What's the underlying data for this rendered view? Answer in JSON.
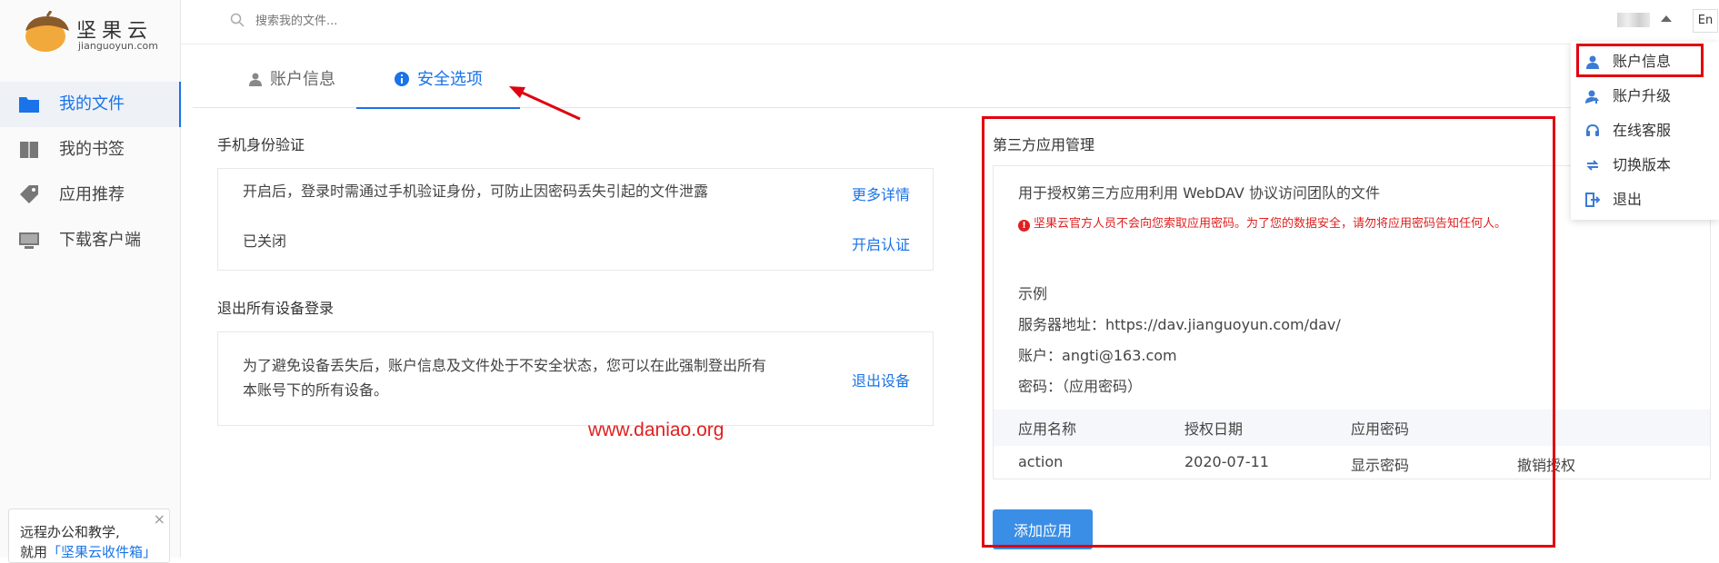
{
  "app": {
    "logo_text": "坚果云",
    "logo_sub": "jianguoyun.com"
  },
  "sidebar": {
    "items": [
      {
        "label": "我的文件",
        "icon": "folder-icon",
        "active": true
      },
      {
        "label": "我的书签",
        "icon": "bookmark-icon",
        "active": false
      },
      {
        "label": "应用推荐",
        "icon": "tag-icon",
        "active": false
      },
      {
        "label": "下载客户端",
        "icon": "monitor-icon",
        "active": false
      }
    ],
    "promo": {
      "line1": "远程办公和教学,",
      "line2_prefix": "就用",
      "line2_link": "「坚果云收件箱」",
      "close": "×"
    }
  },
  "topbar": {
    "search_placeholder": "搜索我的文件...",
    "lang": "En"
  },
  "tabs": [
    {
      "label": "账户信息",
      "icon": "user-icon",
      "active": false
    },
    {
      "label": "安全选项",
      "icon": "info-icon",
      "active": true
    }
  ],
  "phone_auth": {
    "title": "手机身份验证",
    "description": "开启后，登录时需通过手机验证身份，可防止因密码丢失引起的文件泄露",
    "more_link": "更多详情",
    "status": "已关闭",
    "enable_link": "开启认证"
  },
  "logout_all": {
    "title": "退出所有设备登录",
    "description_line1": "为了避免设备丢失后，账户信息及文件处于不安全状态，您可以在此强制登出所有",
    "description_line2": "本账号下的所有设备。",
    "action_link": "退出设备"
  },
  "watermark": "www.daniao.org",
  "third_party": {
    "title": "第三方应用管理",
    "description": "用于授权第三方应用利用 WebDAV 协议访问团队的文件",
    "warning": "坚果云官方人员不会向您索取应用密码。为了您的数据安全，请勿将应用密码告知任何人。",
    "example": {
      "title": "示例",
      "server_label": "服务器地址：",
      "server_value": "https://dav.jianguoyun.com/dav/",
      "account_label": "账户：",
      "account_value": "angti@163.com",
      "password_label": "密码：",
      "password_value": "（应用密码）"
    },
    "table": {
      "headers": [
        "应用名称",
        "授权日期",
        "应用密码"
      ],
      "rows": [
        {
          "name": "action",
          "date": "2020-07-11",
          "show_password": "显示密码",
          "revoke": "撤销授权"
        }
      ]
    },
    "add_button": "添加应用"
  },
  "dropdown": {
    "items": [
      {
        "label": "账户信息",
        "icon": "user-icon"
      },
      {
        "label": "账户升级",
        "icon": "user-upgrade-icon"
      },
      {
        "label": "在线客服",
        "icon": "headset-icon"
      },
      {
        "label": "切换版本",
        "icon": "switch-icon"
      },
      {
        "label": "退出",
        "icon": "logout-icon"
      }
    ]
  },
  "colors": {
    "accent": "#1a73e8",
    "annotation": "#e00010",
    "warning": "#e02020"
  }
}
